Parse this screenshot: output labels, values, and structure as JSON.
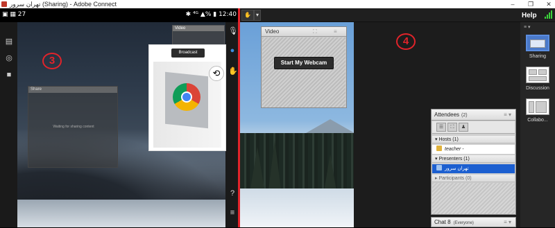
{
  "window": {
    "title": "تهران سرور (Sharing) - Adobe Connect",
    "controls": {
      "minimize": "–",
      "restore": "❐",
      "close": "✕"
    }
  },
  "phone": {
    "status_left": "27",
    "status_right": "12:40",
    "rotate_icon": "rotate-icon",
    "mini_video_title": "Video",
    "mini_share_title": "Share",
    "mini_share_message": "Waiting for sharing content",
    "camera_button": "Broadcast",
    "marker": "3"
  },
  "connect": {
    "help": "Help",
    "marker": "4",
    "colors": {
      "accent_red": "#e2232a",
      "selection_blue": "#1c5fd0",
      "signal_green": "#3bd13b"
    }
  },
  "video_pod": {
    "title": "Video",
    "start_webcam": "Start My Webcam"
  },
  "layouts": {
    "menu": "≡ ▾",
    "items": [
      {
        "label": "Sharing",
        "selected": true
      },
      {
        "label": "Discussion",
        "selected": false
      },
      {
        "label": "Collabo...",
        "selected": false
      }
    ]
  },
  "attendees": {
    "title": "Attendees",
    "count": "(2)",
    "menu": "≡ ▾",
    "hosts_group": "Hosts (1)",
    "host_name": "teacher -",
    "presenters_group": "Presenters (1)",
    "presenter_name": "تهران سرور",
    "participants_group": "Participants (0)"
  },
  "chat": {
    "title": "Chat 8",
    "scope": "(Everyone)",
    "menu": "≡ ▾"
  }
}
